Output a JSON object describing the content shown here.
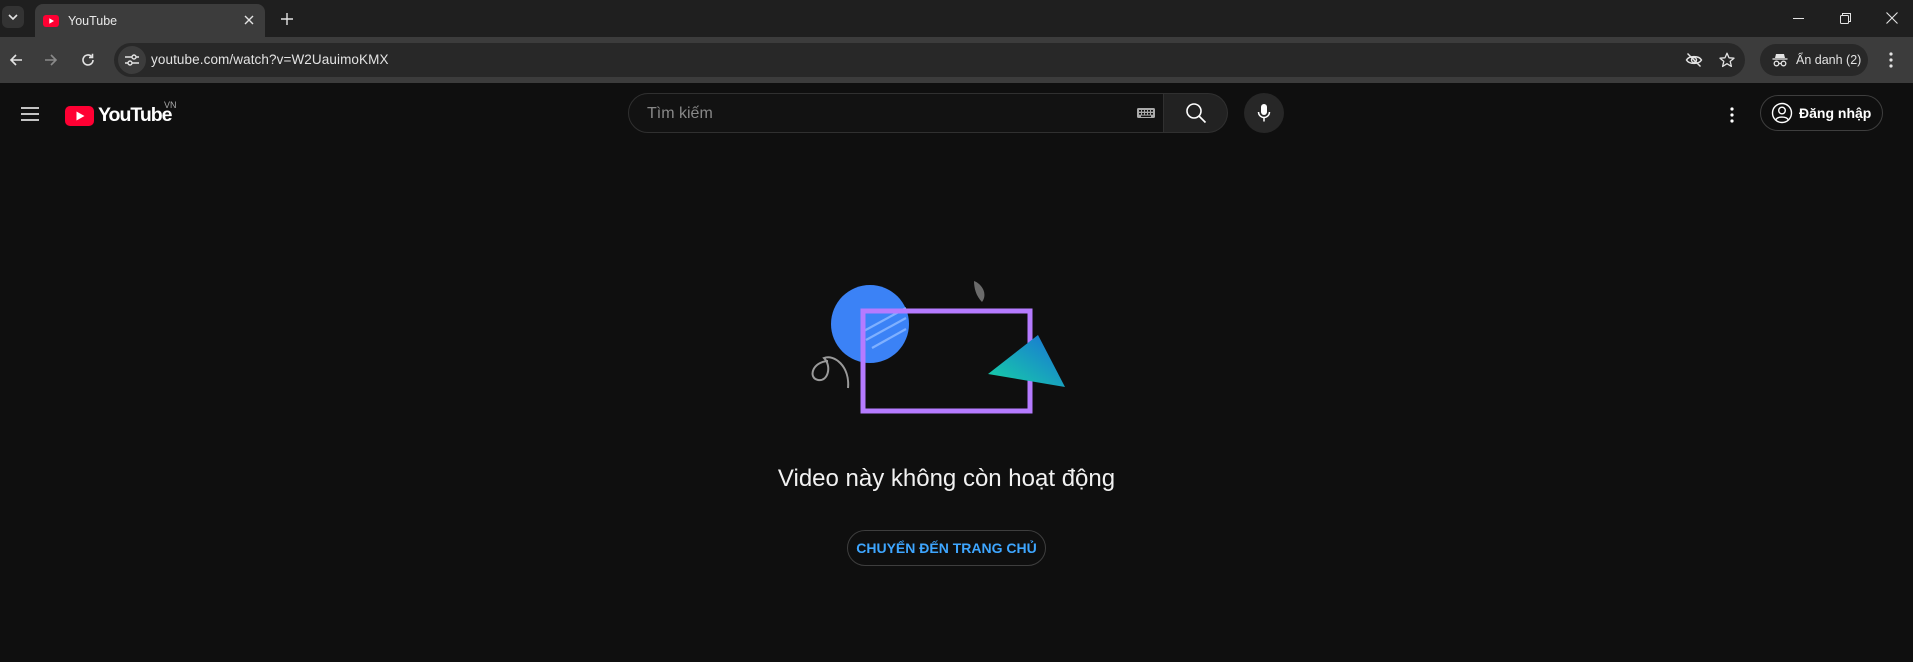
{
  "browser": {
    "tab_title": "YouTube",
    "url": "youtube.com/watch?v=W2UauimoKMX",
    "incognito_label": "Ẩn danh (2)"
  },
  "youtube": {
    "logo_text": "YouTube",
    "country_code": "VN",
    "search_placeholder": "Tìm kiếm",
    "signin_label": "Đăng nhập"
  },
  "main": {
    "message": "Video này không còn hoạt động",
    "home_button_label": "CHUYỂN ĐẾN TRANG CHỦ"
  },
  "colors": {
    "page_bg": "#0f0f0f",
    "brand_red": "#ff0033",
    "link_blue": "#3ea6ff",
    "illustration_purple": "#b57bff",
    "illustration_blue": "#3b82f6",
    "illustration_teal": "#14b8a6"
  },
  "icons": [
    "tab-search-icon",
    "youtube-favicon",
    "close-icon",
    "plus-icon",
    "minimize-icon",
    "restore-icon",
    "window-close-icon",
    "back-icon",
    "forward-icon",
    "reload-icon",
    "site-info-icon",
    "eye-off-icon",
    "star-icon",
    "incognito-icon",
    "more-vert-icon",
    "hamburger-icon",
    "youtube-logo-icon",
    "keyboard-icon",
    "search-icon",
    "mic-icon",
    "account-circle-icon"
  ]
}
